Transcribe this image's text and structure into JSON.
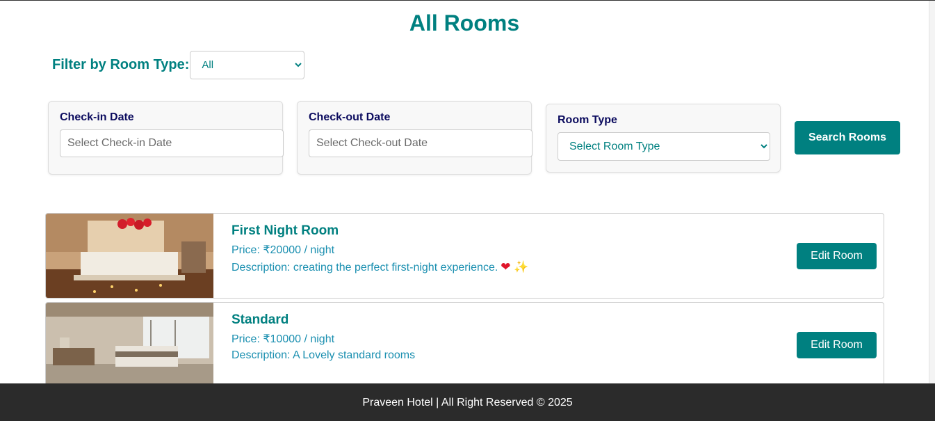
{
  "page": {
    "title": "All Rooms"
  },
  "filter": {
    "label": "Filter by Room Type:",
    "selected": "All"
  },
  "search": {
    "checkin": {
      "label": "Check-in Date",
      "placeholder": "Select Check-in Date"
    },
    "checkout": {
      "label": "Check-out Date",
      "placeholder": "Select Check-out Date"
    },
    "room_type": {
      "label": "Room Type",
      "selected": "Select Room Type"
    },
    "button_label": "Search Rooms"
  },
  "rooms": [
    {
      "name": "First Night Room",
      "price": "Price: ₹20000 / night",
      "description": "Description: creating the perfect first-night experience.",
      "emojis": [
        "❤",
        "✨"
      ],
      "edit_label": "Edit Room"
    },
    {
      "name": "Standard",
      "price": "Price: ₹10000 / night",
      "description": "Description: A Lovely standard rooms",
      "edit_label": "Edit Room"
    }
  ],
  "footer": {
    "text": "Praveen Hotel | All Right Reserved © 2025"
  },
  "colors": {
    "accent": "#008080",
    "label_navy": "#0b0b5e",
    "footer_bg": "#2b2b2b",
    "text_blue": "#1a8fb0"
  }
}
